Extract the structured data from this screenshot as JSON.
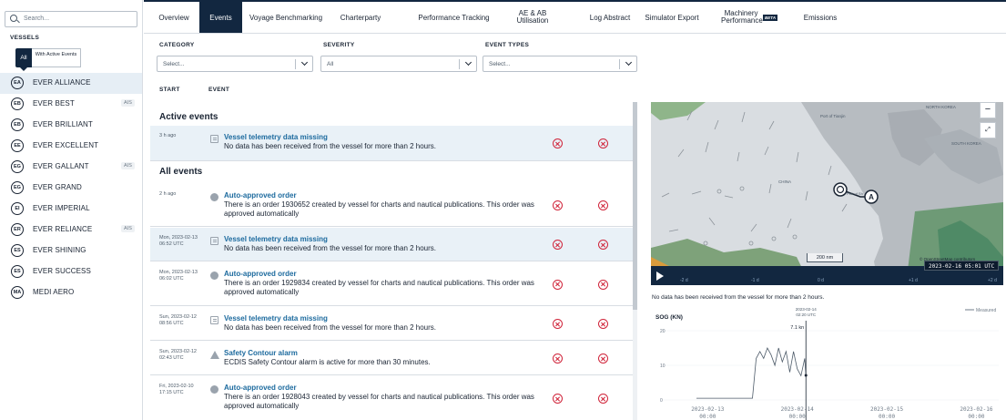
{
  "sidebar": {
    "search_placeholder": "Search...",
    "vessels_heading": "VESSELS",
    "filter_all": "All",
    "filter_active": "With Active Events",
    "vessels": [
      {
        "initials": "EA",
        "name": "EVER ALLIANCE",
        "ais": "",
        "selected": true
      },
      {
        "initials": "EB",
        "name": "EVER BEST",
        "ais": "AIS"
      },
      {
        "initials": "EB",
        "name": "EVER BRILLIANT",
        "ais": ""
      },
      {
        "initials": "EE",
        "name": "EVER EXCELLENT",
        "ais": ""
      },
      {
        "initials": "EG",
        "name": "EVER GALLANT",
        "ais": "AIS"
      },
      {
        "initials": "EG",
        "name": "EVER GRAND",
        "ais": ""
      },
      {
        "initials": "EI",
        "name": "EVER IMPERIAL",
        "ais": ""
      },
      {
        "initials": "ER",
        "name": "EVER RELIANCE",
        "ais": "AIS"
      },
      {
        "initials": "ES",
        "name": "EVER SHINING",
        "ais": ""
      },
      {
        "initials": "ES",
        "name": "EVER SUCCESS",
        "ais": ""
      },
      {
        "initials": "MA",
        "name": "MEDI AERO",
        "ais": ""
      }
    ]
  },
  "tabs": [
    {
      "label": "Overview"
    },
    {
      "label": "Events",
      "active": true
    },
    {
      "label": "Voyage Benchmarking"
    },
    {
      "label": "Charterparty"
    },
    {
      "label": "Performance Tracking"
    },
    {
      "label": "AE & AB Utilisation"
    },
    {
      "label": "Log Abstract"
    },
    {
      "label": "Simulator Export"
    },
    {
      "label": "Machinery Performance",
      "badge": "BETA"
    },
    {
      "label": "Emissions"
    }
  ],
  "filters": {
    "category_label": "CATEGORY",
    "category_value": "Select...",
    "severity_label": "SEVERITY",
    "severity_value": "All",
    "types_label": "EVENT TYPES",
    "types_value": "Select..."
  },
  "columns": {
    "start": "START",
    "event": "EVENT"
  },
  "active_heading": "Active events",
  "all_heading": "All events",
  "active_events": [
    {
      "time": "3 h ago",
      "icon": "message-icon",
      "title": "Vessel telemetry data missing",
      "desc": "No data has been received from the vessel for more than 2 hours."
    }
  ],
  "all_events": [
    {
      "time": "2 h ago",
      "icon": "info-icon",
      "title": "Auto-approved order",
      "desc": "There is an order 1930652 created by vessel for charts and nautical publications. This order was approved automatically"
    },
    {
      "time": "Mon, 2023-02-13 06:52 UTC",
      "icon": "message-icon",
      "title": "Vessel telemetry data missing",
      "desc": "No data has been received from the vessel for more than 2 hours."
    },
    {
      "time": "Mon, 2023-02-13 06:02 UTC",
      "icon": "info-icon",
      "title": "Auto-approved order",
      "desc": "There is an order 1929834 created by vessel for charts and nautical publications. This order was approved automatically"
    },
    {
      "time": "Sun, 2023-02-12 08:56 UTC",
      "icon": "message-icon",
      "title": "Vessel telemetry data missing",
      "desc": "No data has been received from the vessel for more than 2 hours."
    },
    {
      "time": "Sun, 2023-02-12 02:43 UTC",
      "icon": "warning-icon",
      "title": "Safety Contour alarm",
      "desc": "ECDIS Safety Contour alarm is active for more than 30 minutes."
    },
    {
      "time": "Fri, 2023-02-10 17:15 UTC",
      "icon": "info-icon",
      "title": "Auto-approved order",
      "desc": "There is an order 1928043 created by vessel for charts and nautical publications. This order was approved automatically"
    }
  ],
  "map": {
    "labels": [
      "Port of Tianjin",
      "NORTH KOREA",
      "SOUTH KOREA",
      "CHINA",
      "Port of Sh"
    ],
    "scale": "200 nm",
    "copyright": "© OpenStreetMap contributors",
    "timeline_ticks": [
      "-2 d",
      "-1 d",
      "0 d",
      "+1 d",
      "+2 d"
    ],
    "timestamp": "2023-02-16 05:01 UTC"
  },
  "no_data_text": "No data has been received from the vessel for more than 2 hours.",
  "chart_data": {
    "type": "line",
    "title": "",
    "ylabel": "SOG (KN)",
    "legend": "Measured",
    "ylim": [
      0,
      25
    ],
    "yticks": [
      0,
      10,
      20
    ],
    "x_range": [
      "2023-02-12 21:00",
      "2023-02-16 06:00"
    ],
    "xticks": [
      "2023-02-13 00:00",
      "2023-02-14 00:00",
      "2023-02-15 00:00",
      "2023-02-16 00:00"
    ],
    "cursor": {
      "date": "2023-02-14",
      "time": "02:20 UTC",
      "value": "7.1 kn"
    },
    "series": [
      {
        "name": "Measured",
        "x": [
          "2023-02-12 21:00",
          "2023-02-13 00:00",
          "2023-02-13 06:00",
          "2023-02-13 12:00",
          "2023-02-13 13:00",
          "2023-02-13 14:00",
          "2023-02-13 15:00",
          "2023-02-13 16:00",
          "2023-02-13 17:00",
          "2023-02-13 18:00",
          "2023-02-13 19:00",
          "2023-02-13 20:00",
          "2023-02-13 21:00",
          "2023-02-13 22:00",
          "2023-02-13 23:00",
          "2023-02-14 00:00",
          "2023-02-14 01:00",
          "2023-02-14 02:00",
          "2023-02-14 02:20"
        ],
        "y": [
          0.5,
          0.5,
          0.5,
          0.5,
          12,
          14,
          12,
          15,
          13,
          10,
          15,
          11,
          14,
          8,
          14,
          9,
          7,
          12,
          7.1
        ]
      }
    ]
  }
}
